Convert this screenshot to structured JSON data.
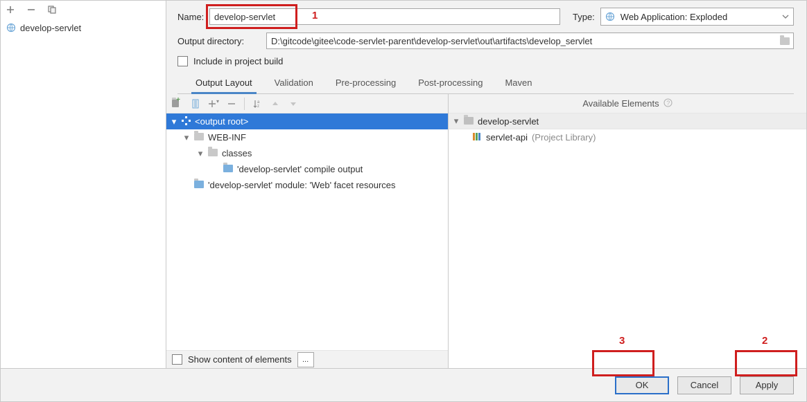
{
  "sidebar": {
    "item0": {
      "label": "develop-servlet"
    }
  },
  "form": {
    "name_label": "Name:",
    "name_value": "develop-servlet",
    "type_label": "Type:",
    "type_value": "Web Application: Exploded",
    "outdir_label": "Output directory:",
    "outdir_value": "D:\\gitcode\\gitee\\code-servlet-parent\\develop-servlet\\out\\artifacts\\develop_servlet",
    "include_build": "Include in project build"
  },
  "tabs": {
    "t0": "Output Layout",
    "t1": "Validation",
    "t2": "Pre-processing",
    "t3": "Post-processing",
    "t4": "Maven"
  },
  "tree": {
    "root": "<output root>",
    "n1": "WEB-INF",
    "n2": "classes",
    "n3": "'develop-servlet' compile output",
    "n4": "'develop-servlet' module: 'Web' facet resources"
  },
  "available": {
    "header": "Available Elements",
    "n0": "develop-servlet",
    "n1": "servlet-api",
    "n1_suffix": "(Project Library)"
  },
  "bottom": {
    "show_content": "Show content of elements",
    "ellipsis": "..."
  },
  "buttons": {
    "ok": "OK",
    "cancel": "Cancel",
    "apply": "Apply"
  },
  "annot": {
    "a1": "1",
    "a2": "2",
    "a3": "3"
  }
}
